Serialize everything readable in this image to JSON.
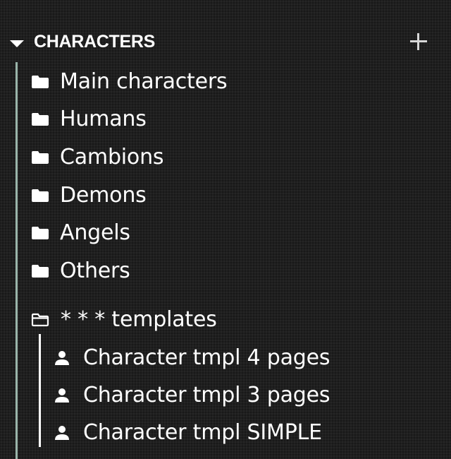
{
  "section": {
    "title": "CHARACTERS",
    "add_icon": "plus-icon",
    "expand_icon": "caret-down-icon"
  },
  "folders": [
    {
      "label": "Main characters",
      "icon": "folder-icon"
    },
    {
      "label": "Humans",
      "icon": "folder-icon"
    },
    {
      "label": "Cambions",
      "icon": "folder-icon"
    },
    {
      "label": "Demons",
      "icon": "folder-icon"
    },
    {
      "label": "Angels",
      "icon": "folder-icon"
    },
    {
      "label": "Others",
      "icon": "folder-icon"
    }
  ],
  "templates_folder": {
    "label": "* * *  templates",
    "icon": "folder-open-icon",
    "items": [
      {
        "label": "Character tmpl 4 pages",
        "icon": "person-icon"
      },
      {
        "label": "Character tmpl 3 pages",
        "icon": "person-icon"
      },
      {
        "label": "Character tmpl SIMPLE",
        "icon": "person-icon"
      }
    ]
  },
  "colors": {
    "background": "#1f1f1f",
    "text": "#ffffff",
    "tree_guide": "#9ab5aa"
  }
}
